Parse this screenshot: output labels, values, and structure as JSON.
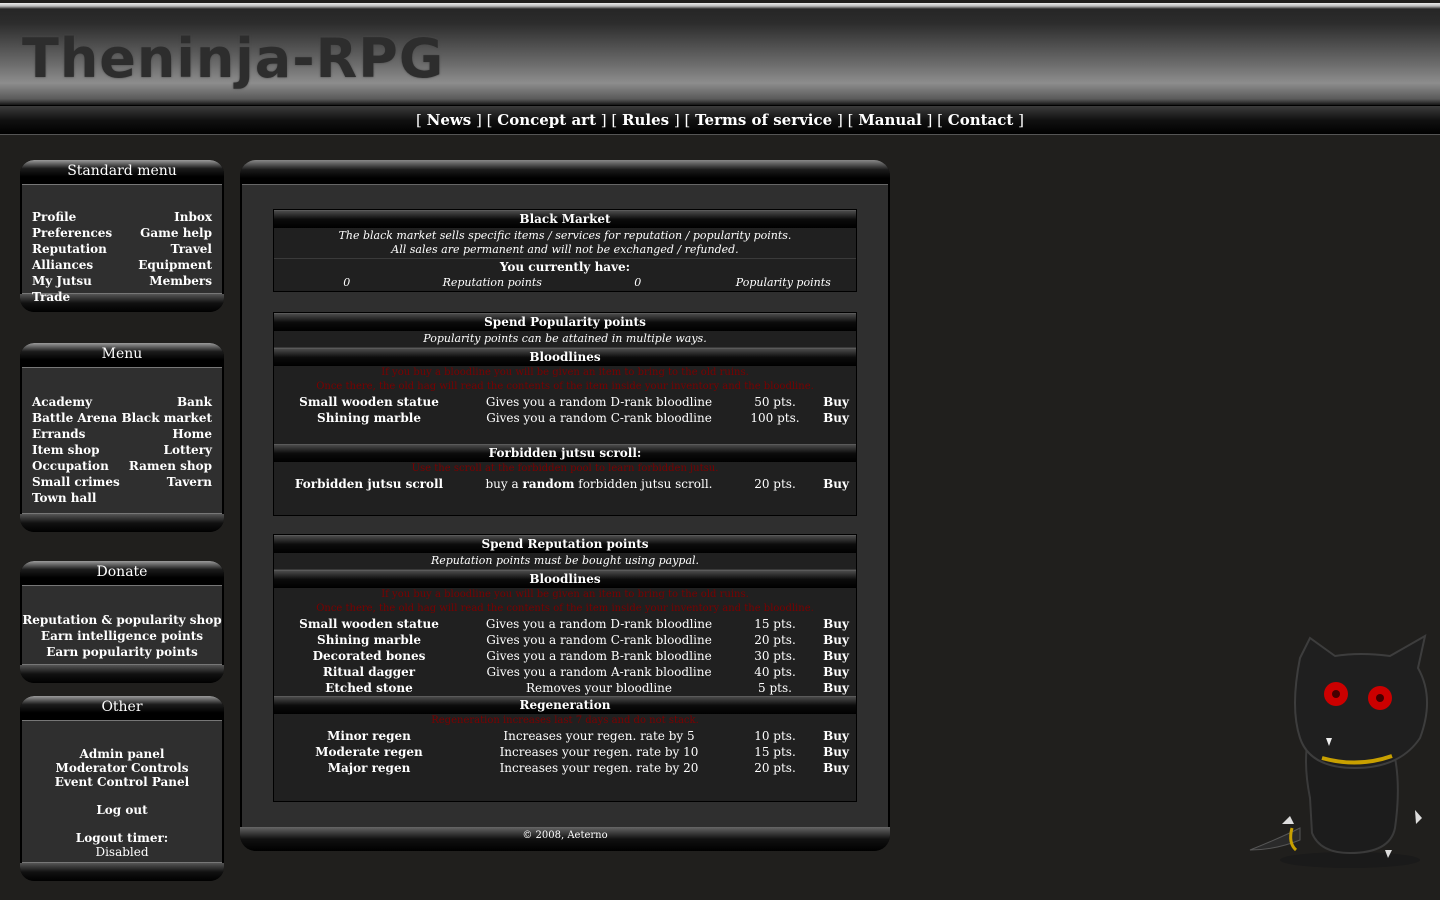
{
  "site": {
    "logo": "Theninja-RPG"
  },
  "topnav": {
    "items": [
      "News",
      "Concept art",
      "Rules",
      "Terms of service",
      "Manual",
      "Contact"
    ]
  },
  "standard_menu": {
    "title": "Standard menu",
    "left": [
      "Profile",
      "Preferences",
      "Reputation",
      "Alliances",
      "My Jutsu",
      "Trade"
    ],
    "right": [
      "Inbox",
      "Game help",
      "Travel",
      "Equipment",
      "Members"
    ]
  },
  "menu": {
    "title": "Menu",
    "left": [
      "Academy",
      "Battle Arena",
      "Errands",
      "Item shop",
      "Occupation",
      "Small crimes",
      "Town hall"
    ],
    "right": [
      "Bank",
      "Black market",
      "Home",
      "Lottery",
      "Ramen shop",
      "Tavern"
    ]
  },
  "donate": {
    "title": "Donate",
    "items": [
      "Reputation & popularity shop",
      "Earn intelligence points",
      "Earn popularity points"
    ]
  },
  "other": {
    "title": "Other",
    "items": [
      "Admin panel",
      "Moderator Controls",
      "Event Control Panel"
    ],
    "logout": "Log out",
    "timer_label": "Logout timer:",
    "timer_value": "Disabled"
  },
  "black_market": {
    "title": "Black Market",
    "intro1": "The black market sells specific items / services for reputation / popularity points.",
    "intro2": "All sales are permanent and will not be exchanged / refunded.",
    "have_label": "You currently have:",
    "rep_value": "0",
    "rep_label": "Reputation points",
    "pop_value": "0",
    "pop_label": "Popularity points"
  },
  "popularity": {
    "title": "Spend Popularity points",
    "intro": "Popularity points can be attained in multiple ways.",
    "bloodlines_title": "Bloodlines",
    "warn1": "If you buy a bloodline you will be given an item to bring to the old ruins.",
    "warn2": "Once there, the old hag will read the contents of the item inside your inventory and the bloodline.",
    "items": [
      {
        "name": "Small wooden statue",
        "desc": "Gives you a random D-rank bloodline",
        "price": "50 pts.",
        "buy": "Buy"
      },
      {
        "name": "Shining marble",
        "desc": "Gives you a random C-rank bloodline",
        "price": "100 pts.",
        "buy": "Buy"
      }
    ],
    "scroll_title": "Forbidden jutsu scroll:",
    "scroll_warn": "Use the scroll at the forbidden pool to learn forbidden jutsu.",
    "scroll_item": {
      "name": "Forbidden jutsu scroll",
      "desc_pre": "buy a",
      "desc_bold": "random",
      "desc_post": "forbidden jutsu scroll.",
      "price": "20 pts.",
      "buy": "Buy"
    }
  },
  "reputation": {
    "title": "Spend Reputation points",
    "intro": "Reputation points must be bought using paypal.",
    "bloodlines_title": "Bloodlines",
    "warn1": "If you buy a bloodline you will be given an item to bring to the old ruins.",
    "warn2": "Once there, the old hag will read the contents of the item inside your inventory and the bloodline.",
    "items": [
      {
        "name": "Small wooden statue",
        "desc": "Gives you a random D-rank bloodline",
        "price": "15 pts.",
        "buy": "Buy"
      },
      {
        "name": "Shining marble",
        "desc": "Gives you a random C-rank bloodline",
        "price": "20 pts.",
        "buy": "Buy"
      },
      {
        "name": "Decorated bones",
        "desc": "Gives you a random B-rank bloodline",
        "price": "30 pts.",
        "buy": "Buy"
      },
      {
        "name": "Ritual dagger",
        "desc": "Gives you a random A-rank bloodline",
        "price": "40 pts.",
        "buy": "Buy"
      },
      {
        "name": "Etched stone",
        "desc": "Removes your bloodline",
        "price": "5 pts.",
        "buy": "Buy"
      }
    ],
    "regen_title": "Regeneration",
    "regen_warn": "Regeneration increases last 7 days and do not stack.",
    "regen_items": [
      {
        "name": "Minor regen",
        "desc": "Increases your regen. rate by 5",
        "price": "10 pts.",
        "buy": "Buy"
      },
      {
        "name": "Moderate regen",
        "desc": "Increases your regen. rate by 10",
        "price": "15 pts.",
        "buy": "Buy"
      },
      {
        "name": "Major regen",
        "desc": "Increases your regen. rate by 20",
        "price": "20 pts.",
        "buy": "Buy"
      }
    ]
  },
  "footer": {
    "copyright": "© 2008, Aeterno"
  },
  "colors": {
    "background": "#201f1d",
    "warning": "#7a0000",
    "mascot_eyes": "#cc0000",
    "collar": "#c8a000"
  }
}
